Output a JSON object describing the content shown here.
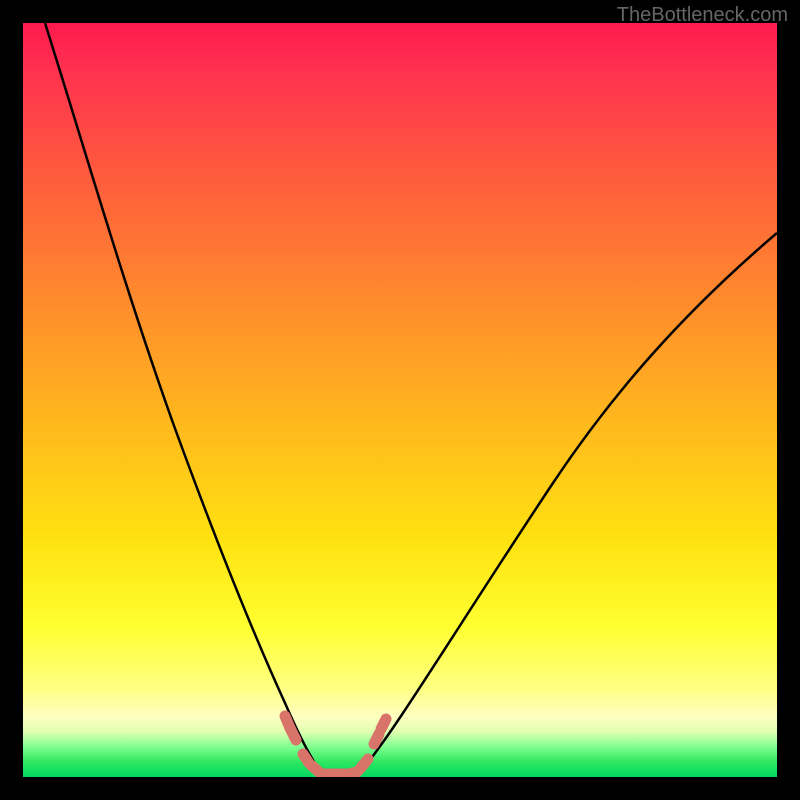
{
  "watermark": "TheBottleneck.com",
  "chart_data": {
    "type": "line",
    "title": "",
    "xlabel": "",
    "ylabel": "",
    "xlim": [
      0,
      100
    ],
    "ylim": [
      0,
      100
    ],
    "series": [
      {
        "name": "left-curve",
        "x": [
          3,
          8,
          12,
          16,
          20,
          24,
          28,
          32,
          34,
          36,
          37,
          38,
          39,
          40
        ],
        "y": [
          100,
          83,
          70,
          58,
          47,
          36,
          26,
          16,
          10,
          6,
          4,
          2,
          1,
          0
        ]
      },
      {
        "name": "right-curve",
        "x": [
          44,
          46,
          50,
          55,
          60,
          66,
          74,
          82,
          90,
          100
        ],
        "y": [
          0,
          2,
          7,
          14,
          22,
          31,
          42,
          53,
          62,
          72
        ]
      },
      {
        "name": "bottom-dashes",
        "x": [
          35,
          36,
          38,
          39,
          40,
          41,
          42,
          43,
          44,
          45,
          46,
          47
        ],
        "y": [
          7,
          6,
          2,
          1,
          0,
          0,
          0,
          0,
          0,
          1,
          3,
          5
        ]
      }
    ],
    "gradient_stops": [
      {
        "pos": 0,
        "color": "#ff1a4d"
      },
      {
        "pos": 50,
        "color": "#ffb020"
      },
      {
        "pos": 88,
        "color": "#ffff80"
      },
      {
        "pos": 100,
        "color": "#00d860"
      }
    ]
  }
}
